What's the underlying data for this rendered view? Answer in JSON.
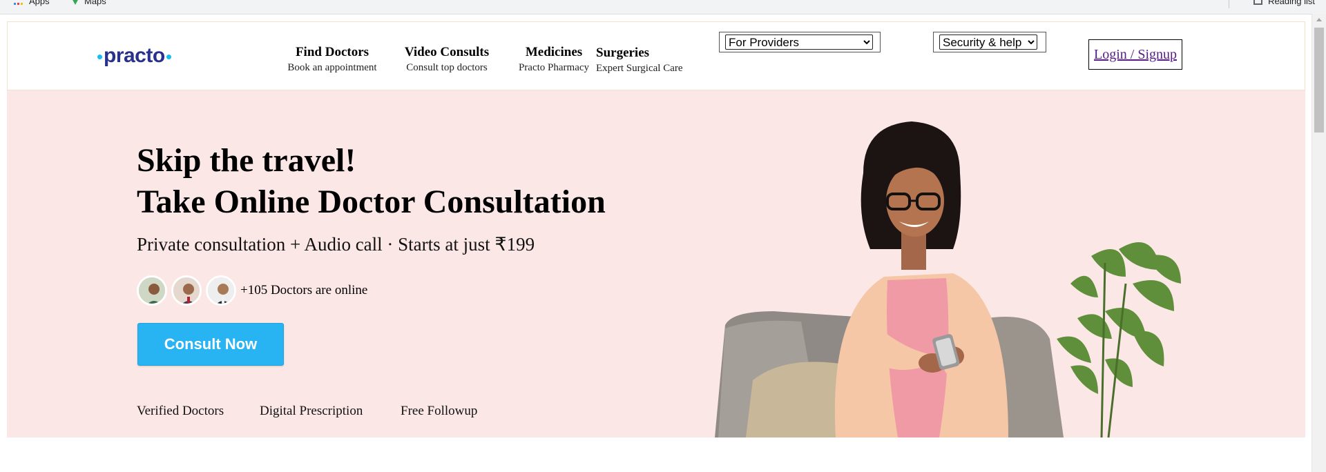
{
  "bookmarks": {
    "apps_label": "Apps",
    "maps_label": "Maps",
    "reading_list_label": "Reading list"
  },
  "logo": {
    "text": "practo"
  },
  "nav": {
    "items": [
      {
        "title": "Find Doctors",
        "subtitle": "Book an appointment"
      },
      {
        "title": "Video Consults",
        "subtitle": "Consult top doctors"
      },
      {
        "title": "Medicines",
        "subtitle": "Practo Pharmacy"
      },
      {
        "title": "Surgeries",
        "subtitle": "Expert Surgical Care"
      }
    ],
    "providers_select": {
      "selected": "For Providers"
    },
    "security_select": {
      "selected": "Security & help"
    },
    "login_label": "Login / Signup"
  },
  "hero": {
    "title_line1": "Skip the travel!",
    "title_line2": "Take Online Doctor Consultation",
    "subtitle": "Private consultation + Audio call · Starts at just ₹199",
    "online_text": "+105 Doctors are online",
    "cta_label": "Consult Now",
    "features": [
      "Verified Doctors",
      "Digital Prescription",
      "Free Followup"
    ]
  },
  "colors": {
    "brand_blue": "#14bef0",
    "brand_navy": "#28328c",
    "hero_bg": "#fbe7e6",
    "cta_bg": "#28b3f2",
    "link_visited": "#551a8b"
  }
}
